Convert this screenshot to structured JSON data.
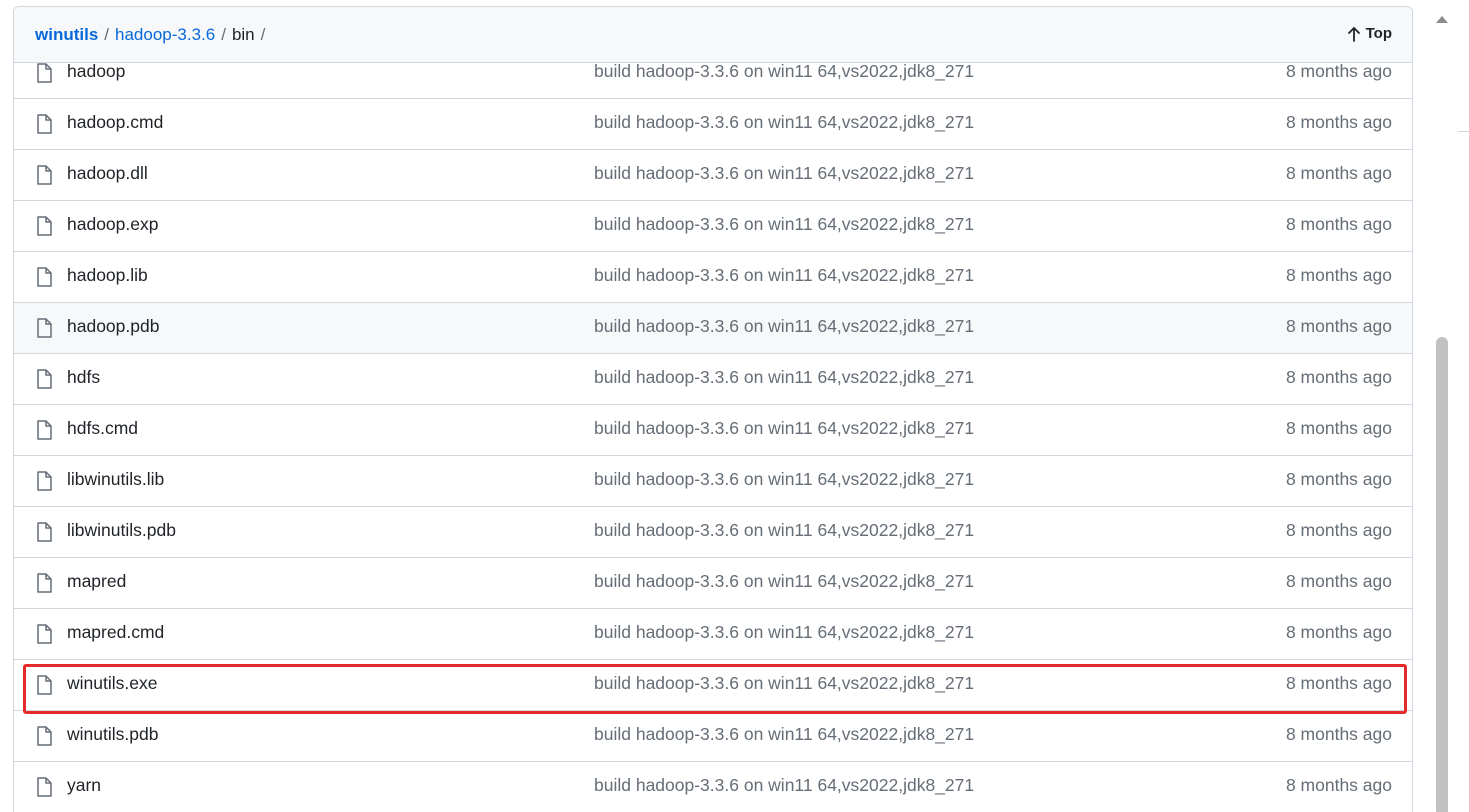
{
  "breadcrumb": {
    "repo": "winutils",
    "folder": "hadoop-3.3.6",
    "current": "bin",
    "separator": "/"
  },
  "top_link": {
    "label": "Top",
    "icon": "arrow-up-icon"
  },
  "commit_message": "build hadoop-3.3.6 on win11 64,vs2022,jdk8_271",
  "files": [
    {
      "name": "hadoop",
      "commit": "build hadoop-3.3.6 on win11 64,vs2022,jdk8_271",
      "age": "8 months ago"
    },
    {
      "name": "hadoop.cmd",
      "commit": "build hadoop-3.3.6 on win11 64,vs2022,jdk8_271",
      "age": "8 months ago"
    },
    {
      "name": "hadoop.dll",
      "commit": "build hadoop-3.3.6 on win11 64,vs2022,jdk8_271",
      "age": "8 months ago"
    },
    {
      "name": "hadoop.exp",
      "commit": "build hadoop-3.3.6 on win11 64,vs2022,jdk8_271",
      "age": "8 months ago"
    },
    {
      "name": "hadoop.lib",
      "commit": "build hadoop-3.3.6 on win11 64,vs2022,jdk8_271",
      "age": "8 months ago"
    },
    {
      "name": "hadoop.pdb",
      "commit": "build hadoop-3.3.6 on win11 64,vs2022,jdk8_271",
      "age": "8 months ago"
    },
    {
      "name": "hdfs",
      "commit": "build hadoop-3.3.6 on win11 64,vs2022,jdk8_271",
      "age": "8 months ago"
    },
    {
      "name": "hdfs.cmd",
      "commit": "build hadoop-3.3.6 on win11 64,vs2022,jdk8_271",
      "age": "8 months ago"
    },
    {
      "name": "libwinutils.lib",
      "commit": "build hadoop-3.3.6 on win11 64,vs2022,jdk8_271",
      "age": "8 months ago"
    },
    {
      "name": "libwinutils.pdb",
      "commit": "build hadoop-3.3.6 on win11 64,vs2022,jdk8_271",
      "age": "8 months ago"
    },
    {
      "name": "mapred",
      "commit": "build hadoop-3.3.6 on win11 64,vs2022,jdk8_271",
      "age": "8 months ago"
    },
    {
      "name": "mapred.cmd",
      "commit": "build hadoop-3.3.6 on win11 64,vs2022,jdk8_271",
      "age": "8 months ago"
    },
    {
      "name": "winutils.exe",
      "commit": "build hadoop-3.3.6 on win11 64,vs2022,jdk8_271",
      "age": "8 months ago"
    },
    {
      "name": "winutils.pdb",
      "commit": "build hadoop-3.3.6 on win11 64,vs2022,jdk8_271",
      "age": "8 months ago"
    },
    {
      "name": "yarn",
      "commit": "build hadoop-3.3.6 on win11 64,vs2022,jdk8_271",
      "age": "8 months ago"
    }
  ],
  "hovered_file": "hadoop.pdb",
  "highlighted_file": "winutils.exe",
  "colors": {
    "link": "#0969da",
    "muted_text": "#656d76",
    "border": "#d0d7de",
    "header_bg": "#f6f8fa",
    "highlight_box": "#e32b2b"
  }
}
